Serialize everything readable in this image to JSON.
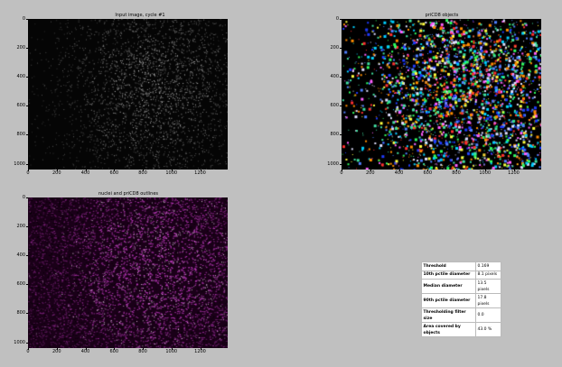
{
  "panels": [
    {
      "title": "Input image, cycle #1",
      "style": "gray",
      "yticks": [
        "0",
        "200",
        "400",
        "600",
        "800",
        "1000"
      ],
      "xticks": [
        "0",
        "200",
        "400",
        "600",
        "800",
        "1000",
        "1200"
      ]
    },
    {
      "title": "priCD8 objects",
      "style": "labels",
      "yticks": [
        "0",
        "200",
        "400",
        "600",
        "800",
        "1000"
      ],
      "xticks": [
        "0",
        "200",
        "400",
        "600",
        "800",
        "1000",
        "1200"
      ]
    },
    {
      "title": "nuclei and priCD8 outlines",
      "style": "outlines",
      "yticks": [
        "0",
        "200",
        "400",
        "600",
        "800",
        "1000"
      ],
      "xticks": [
        "0",
        "200",
        "400",
        "600",
        "800",
        "1000",
        "1200"
      ]
    }
  ],
  "stats_table": {
    "rows": [
      {
        "label": "Threshold",
        "value": "0.169"
      },
      {
        "label": "10th pctile diameter",
        "value": "8.1 pixels"
      },
      {
        "label": "Median diameter",
        "value": "13.5 pixels"
      },
      {
        "label": "90th pctile diameter",
        "value": "17.8 pixels"
      },
      {
        "label": "Thresholding filter size",
        "value": "0.0"
      },
      {
        "label": "Area covered by objects",
        "value": "43.0 %"
      }
    ]
  },
  "colors": {
    "background": "#c0c0c0",
    "outline_magenta": "#c040c0"
  }
}
